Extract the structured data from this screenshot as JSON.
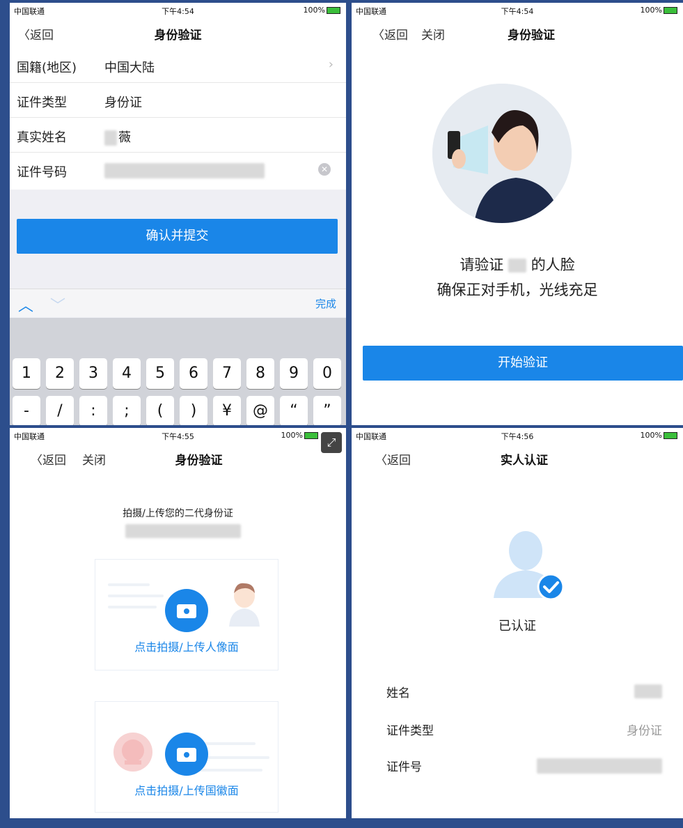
{
  "status_bars": [
    {
      "carrier": "中国联通",
      "time": "下午4:54",
      "battery": "100%"
    },
    {
      "carrier": "中国联通",
      "time": "下午4:54",
      "battery": "100%"
    },
    {
      "carrier": "中国联通",
      "time": "下午4:55",
      "battery": "100%"
    },
    {
      "carrier": "中国联通",
      "time": "下午4:56",
      "battery": "100%"
    }
  ],
  "panel1": {
    "back": "返回",
    "title": "身份验证",
    "rows": [
      {
        "label": "国籍(地区)",
        "value": "中国大陆"
      },
      {
        "label": "证件类型",
        "value": "身份证"
      },
      {
        "label": "真实姓名",
        "value": "薇"
      },
      {
        "label": "证件号码",
        "value": ""
      }
    ],
    "submit": "确认并提交",
    "done": "完成",
    "keys_row1": [
      "1",
      "2",
      "3",
      "4",
      "5",
      "6",
      "7",
      "8",
      "9",
      "0"
    ],
    "keys_row2": [
      "-",
      "/",
      ":",
      ";",
      "(",
      ")",
      "¥",
      "@",
      "“",
      "”"
    ]
  },
  "panel2": {
    "back": "返回",
    "close": "关闭",
    "title": "身份验证",
    "prompt1_prefix": "请验证",
    "prompt1_suffix": "的人脸",
    "prompt2": "确保正对手机，光线充足",
    "start": "开始验证"
  },
  "panel3": {
    "back": "返回",
    "close": "关闭",
    "title": "身份验证",
    "subtitle": "拍摄/上传您的二代身份证",
    "front_caption": "点击拍摄/上传人像面",
    "back_caption": "点击拍摄/上传国徽面"
  },
  "panel4": {
    "back": "返回",
    "title": "实人认证",
    "status": "已认证",
    "rows": [
      {
        "label": "姓名",
        "value": ""
      },
      {
        "label": "证件类型",
        "value": "身份证"
      },
      {
        "label": "证件号",
        "value": ""
      }
    ]
  },
  "colors": {
    "accent": "#1a86e8",
    "frame": "#2d4e8c"
  }
}
